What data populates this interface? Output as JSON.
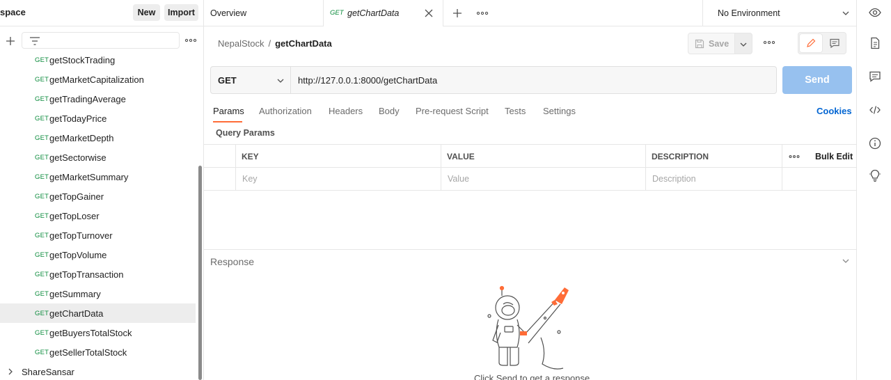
{
  "workspace": {
    "title": "space",
    "new_label": "New",
    "import_label": "Import"
  },
  "sidebar": {
    "requests": [
      {
        "method": "GET",
        "name": "getStockTrading"
      },
      {
        "method": "GET",
        "name": "getMarketCapitalization"
      },
      {
        "method": "GET",
        "name": "getTradingAverage"
      },
      {
        "method": "GET",
        "name": "getTodayPrice"
      },
      {
        "method": "GET",
        "name": "getMarketDepth"
      },
      {
        "method": "GET",
        "name": "getSectorwise"
      },
      {
        "method": "GET",
        "name": "getMarketSummary"
      },
      {
        "method": "GET",
        "name": "getTopGainer"
      },
      {
        "method": "GET",
        "name": "getTopLoser"
      },
      {
        "method": "GET",
        "name": "getTopTurnover"
      },
      {
        "method": "GET",
        "name": "getTopVolume"
      },
      {
        "method": "GET",
        "name": "getTopTransaction"
      },
      {
        "method": "GET",
        "name": "getSummary"
      },
      {
        "method": "GET",
        "name": "getChartData",
        "active": true
      },
      {
        "method": "GET",
        "name": "getBuyersTotalStock"
      },
      {
        "method": "GET",
        "name": "getSellerTotalStock"
      }
    ],
    "folder": {
      "name": "ShareSansar"
    }
  },
  "tabs": {
    "overview_label": "Overview",
    "active": {
      "method": "GET",
      "label": "getChartData"
    },
    "environment": "No Environment"
  },
  "request": {
    "breadcrumb": {
      "collection": "NepalStock",
      "separator": "/",
      "request": "getChartData"
    },
    "save_label": "Save",
    "method": "GET",
    "url": "http://127.0.0.1:8000/getChartData",
    "send_label": "Send",
    "tabs": [
      "Params",
      "Authorization",
      "Headers",
      "Body",
      "Pre-request Script",
      "Tests",
      "Settings"
    ],
    "active_tab": "Params",
    "cookies_label": "Cookies",
    "query_params": {
      "title": "Query Params",
      "headers": {
        "key": "KEY",
        "value": "VALUE",
        "description": "DESCRIPTION",
        "bulk_edit": "Bulk Edit"
      },
      "placeholders": {
        "key": "Key",
        "value": "Value",
        "description": "Description"
      }
    }
  },
  "response": {
    "title": "Response",
    "hint": "Click Send to get a response"
  },
  "colors": {
    "accent": "#ff6c37",
    "send_button": "#97c1ef",
    "method_get": "#0b8b3c",
    "link": "#0265d2"
  },
  "icons": [
    "plus-icon",
    "filter-icon",
    "more-icon",
    "close-icon",
    "chevron-down-icon",
    "eye-icon",
    "document-icon",
    "comment-icon",
    "code-icon",
    "info-icon",
    "bulb-icon",
    "save-icon",
    "edit-icon",
    "chevron-right-icon"
  ]
}
